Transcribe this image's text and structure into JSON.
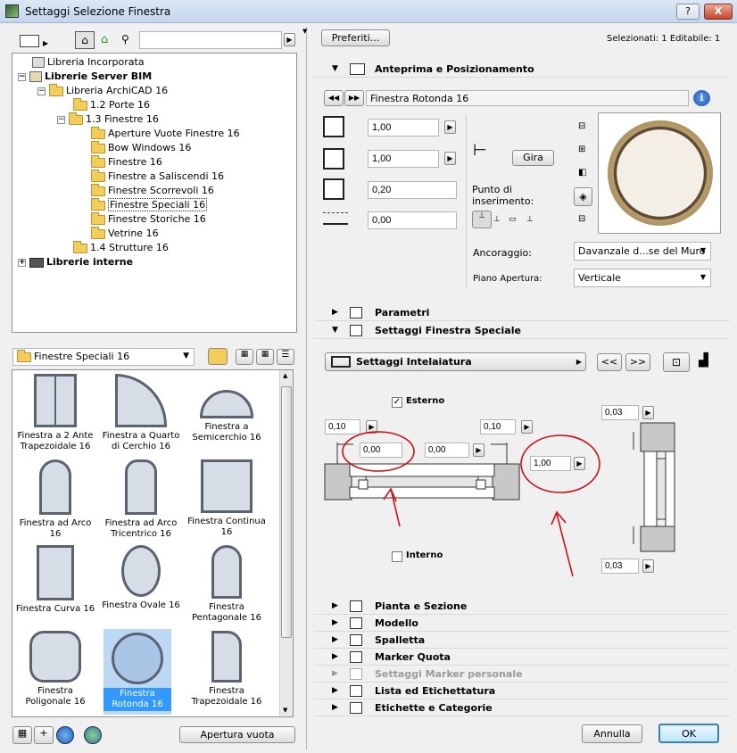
{
  "window": {
    "title": "Settaggi Selezione Finestra",
    "help": "?",
    "close": "X"
  },
  "left": {
    "search_placeholder": "",
    "tree": [
      {
        "label": "Libreria Incorporata"
      },
      {
        "label": "Librerie Server BIM"
      },
      {
        "label": "Libreria ArchiCAD 16"
      },
      {
        "label": "1.2 Porte 16"
      },
      {
        "label": "1.3 Finestre 16"
      },
      {
        "label": "Aperture Vuote Finestre 16"
      },
      {
        "label": "Bow Windows 16"
      },
      {
        "label": "Finestre 16"
      },
      {
        "label": "Finestre a Saliscendi 16"
      },
      {
        "label": "Finestre Scorrevoli 16"
      },
      {
        "label": "Finestre Speciali 16"
      },
      {
        "label": "Finestre Storiche 16"
      },
      {
        "label": "Vetrine 16"
      },
      {
        "label": "1.4 Strutture 16"
      },
      {
        "label": "Librerie interne"
      }
    ],
    "folder_select": "Finestre Speciali 16",
    "gallery": [
      {
        "label": "Finestra a 2 Ante Trapezoidale 16"
      },
      {
        "label": "Finestra a Quarto di Cerchio 16"
      },
      {
        "label": "Finestra a Semicerchio 16"
      },
      {
        "label": "Finestra ad Arco 16"
      },
      {
        "label": "Finestra ad Arco Tricentrico 16"
      },
      {
        "label": "Finestra Continua 16"
      },
      {
        "label": "Finestra Curva 16"
      },
      {
        "label": "Finestra Ovale 16"
      },
      {
        "label": "Finestra Pentagonale 16"
      },
      {
        "label": "Finestra Poligonale 16"
      },
      {
        "label": "Finestra Rotonda 16"
      },
      {
        "label": "Finestra Trapezoidale 16"
      }
    ],
    "open_empty": "Apertura vuota"
  },
  "right": {
    "favorites": "Preferiti...",
    "selection_info": "Selezionati: 1 Editabile: 1",
    "preview_section": "Anteprima e Posizionamento",
    "object_name": "Finestra Rotonda 16",
    "dims": [
      "1,00",
      "1,00",
      "0,20",
      "0,00"
    ],
    "rotate": "Gira",
    "anchor_point": "Punto di inserimento:",
    "anchor_label": "Ancoraggio:",
    "anchor_value": "Davanzale d...se del Muro",
    "plane_label": "Piano Apertura:",
    "plane_value": "Verticale",
    "params_section": "Parametri",
    "special_section": "Settaggi Finestra Speciale",
    "frame_settings": "Settaggi Intelaiatura",
    "prev": "<<",
    "next": ">>",
    "exterior": "Esterno",
    "interior": "Interno",
    "values": {
      "left_w": "0,10",
      "right_w": "0,10",
      "offset_l": "0,00",
      "offset_r": "0,00",
      "depth": "1,00",
      "top": "0,03",
      "bottom": "0,03"
    },
    "sections": [
      "Pianta e Sezione",
      "Modello",
      "Spalletta",
      "Marker Quota",
      "Settaggi Marker personale",
      "Lista ed Etichettatura",
      "Etichette e Categorie"
    ]
  },
  "footer": {
    "cancel": "Annulla",
    "ok": "OK"
  },
  "colors": {
    "selection": "#3399ff",
    "annotation_red": "#d10f16",
    "titlebar": "#c4d6ec"
  }
}
